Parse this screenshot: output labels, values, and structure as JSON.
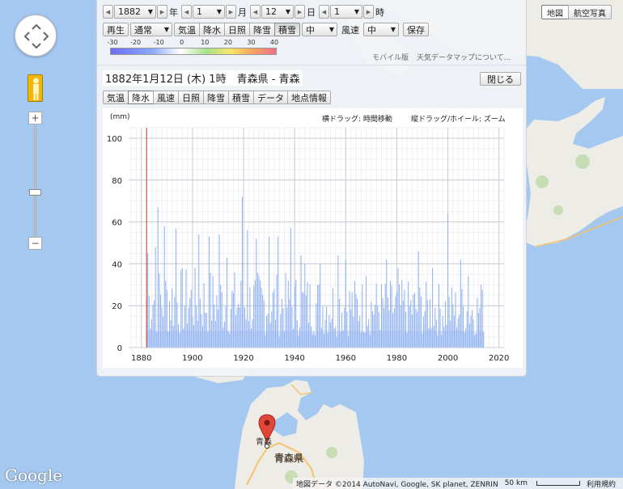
{
  "toolbar": {
    "year": "1882",
    "year_unit": "年",
    "month": "1",
    "month_unit": "月",
    "day": "12",
    "day_unit": "日",
    "hour": "1",
    "hour_unit": "時",
    "play_label": "再生",
    "speed_label": "通常",
    "layers": [
      {
        "label": "気温",
        "pressed": false
      },
      {
        "label": "降水",
        "pressed": false
      },
      {
        "label": "日照",
        "pressed": false
      },
      {
        "label": "降雪",
        "pressed": false
      },
      {
        "label": "積雪",
        "pressed": true
      }
    ],
    "size_label": "中",
    "wind_label": "風速",
    "wind_value": "中",
    "save_label": "保存"
  },
  "legend": {
    "ticks": [
      "-30",
      "-20",
      "-10",
      "0",
      "10",
      "20",
      "30",
      "40"
    ]
  },
  "links": {
    "mobile": "モバイル版",
    "about": "天気データマップについて..."
  },
  "station": {
    "title": "1882年1月12日 (木) 1時　青森県 - 青森",
    "close_label": "閉じる",
    "tabs": [
      {
        "label": "気温",
        "active": false
      },
      {
        "label": "降水",
        "active": true
      },
      {
        "label": "風速",
        "active": false
      },
      {
        "label": "日照",
        "active": false
      },
      {
        "label": "降雪",
        "active": false
      },
      {
        "label": "積雪",
        "active": false
      },
      {
        "label": "データ",
        "active": false
      },
      {
        "label": "地点情報",
        "active": false
      }
    ]
  },
  "chart_hints": {
    "unit": "(mm)",
    "drag_h": "横ドラッグ: 時間移動",
    "drag_v": "縦ドラッグ/ホイール: ズーム"
  },
  "chart_data": {
    "type": "bar",
    "title": "",
    "ylabel": "(mm)",
    "xlim": [
      1875,
      2022
    ],
    "ylim": [
      0,
      105
    ],
    "x_ticks": [
      1880,
      1900,
      1920,
      1940,
      1960,
      1980,
      2000,
      2020
    ],
    "y_ticks": [
      0,
      20,
      40,
      60,
      80,
      100
    ],
    "cursor_x": 1882.03,
    "series_start": 1882,
    "series_end": 2014,
    "colors": {
      "bar": "#8fb0f0",
      "fill": "#dde7fb",
      "cursor": "#c0392b"
    },
    "peaks": [
      {
        "x": 1882.5,
        "y": 45
      },
      {
        "x": 1885.5,
        "y": 48
      },
      {
        "x": 1886.6,
        "y": 67
      },
      {
        "x": 1889.0,
        "y": 58
      },
      {
        "x": 1893.5,
        "y": 57
      },
      {
        "x": 1902.5,
        "y": 54
      },
      {
        "x": 1906.4,
        "y": 53
      },
      {
        "x": 1910.5,
        "y": 54
      },
      {
        "x": 1913.5,
        "y": 43
      },
      {
        "x": 1919.4,
        "y": 72
      },
      {
        "x": 1921.5,
        "y": 56
      },
      {
        "x": 1925.0,
        "y": 52
      },
      {
        "x": 1930.0,
        "y": 53
      },
      {
        "x": 1933.5,
        "y": 53
      },
      {
        "x": 1938.5,
        "y": 57
      },
      {
        "x": 1942.5,
        "y": 44
      },
      {
        "x": 1944.0,
        "y": 40
      },
      {
        "x": 1950.0,
        "y": 40
      },
      {
        "x": 1957.0,
        "y": 44
      },
      {
        "x": 1960.0,
        "y": 42
      },
      {
        "x": 1968.0,
        "y": 34
      },
      {
        "x": 1976.0,
        "y": 42
      },
      {
        "x": 1980.5,
        "y": 38
      },
      {
        "x": 1988.5,
        "y": 46
      },
      {
        "x": 1994.0,
        "y": 38
      },
      {
        "x": 2000.0,
        "y": 64
      },
      {
        "x": 2005.0,
        "y": 42
      },
      {
        "x": 2008.0,
        "y": 34
      },
      {
        "x": 2013.0,
        "y": 30
      }
    ],
    "typical_range": [
      5,
      30
    ],
    "baseline_fill": 8
  },
  "map": {
    "city": "青森",
    "prefecture": "青森県",
    "map_btn": "地図",
    "satellite_btn": "航空写真",
    "copyright": "地図データ ©2014 AutoNavi, Google, SK planet, ZENRIN",
    "scale": "50 km",
    "terms": "利用規約",
    "logo": "Google"
  }
}
